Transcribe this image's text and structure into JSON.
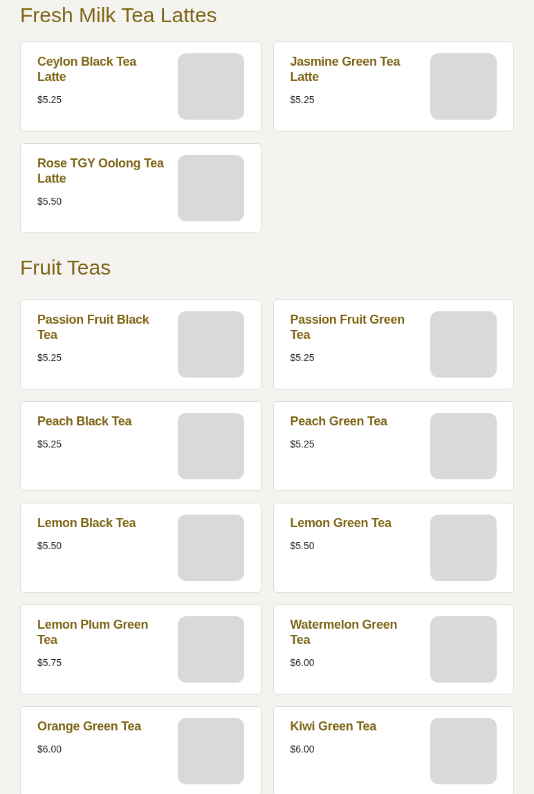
{
  "sections": [
    {
      "title": "Fresh Milk Tea Lattes",
      "items": [
        {
          "name": "Ceylon Black Tea Latte",
          "price": "$5.25"
        },
        {
          "name": "Jasmine Green Tea Latte",
          "price": "$5.25"
        },
        {
          "name": "Rose TGY Oolong Tea Latte",
          "price": "$5.50"
        }
      ]
    },
    {
      "title": "Fruit Teas",
      "items": [
        {
          "name": "Passion Fruit Black Tea",
          "price": "$5.25"
        },
        {
          "name": "Passion Fruit Green Tea",
          "price": "$5.25"
        },
        {
          "name": "Peach Black Tea",
          "price": "$5.25"
        },
        {
          "name": "Peach Green Tea",
          "price": "$5.25"
        },
        {
          "name": "Lemon Black Tea",
          "price": "$5.50"
        },
        {
          "name": "Lemon Green Tea",
          "price": "$5.50"
        },
        {
          "name": "Lemon Plum Green Tea",
          "price": "$5.75"
        },
        {
          "name": "Watermelon Green Tea",
          "price": "$6.00"
        },
        {
          "name": "Orange Green Tea",
          "price": "$6.00"
        },
        {
          "name": "Kiwi Green Tea",
          "price": "$6.00"
        }
      ]
    }
  ]
}
